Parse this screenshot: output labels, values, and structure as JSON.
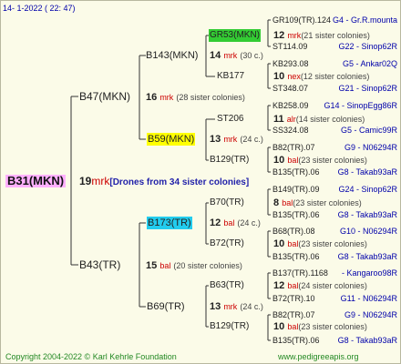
{
  "header": {
    "date": "14-  1-2022 ( 22: 47)"
  },
  "root": {
    "label": "B31(MKN)",
    "number": "19",
    "mark": "mrk",
    "note": "[Drones from 34 sister colonies]"
  },
  "branches": {
    "b47": {
      "label": "B47(MKN)",
      "number": "16",
      "mark": "mrk",
      "note": "(28 sister colonies)"
    },
    "b43": {
      "label": "B43(TR)",
      "number": "15",
      "mark": "bal",
      "note": "(20 sister colonies)"
    },
    "b143": {
      "label": "B143(MKN)",
      "number": "14",
      "mark": "mrk",
      "note": "(30 c.)"
    },
    "b59": {
      "label": "B59(MKN)",
      "number": "13",
      "mark": "mrk",
      "note": "(24 c.)"
    },
    "b173": {
      "label": "B173(TR)",
      "number": "12",
      "mark": "bal",
      "note": "(24 c.)"
    },
    "b69": {
      "label": "B69(TR)",
      "number": "13",
      "mark": "mrk",
      "note": "(24 c.)"
    },
    "gr53": {
      "label": "GR53(MKN)",
      "number": "12",
      "mark": "mrk",
      "note": "(21 sister colonies)"
    },
    "kb177": {
      "label": "KB177",
      "number": "10",
      "mark": "nex",
      "note": "(12 sister colonies)"
    },
    "st206": {
      "label": "ST206",
      "number": "11",
      "mark": "alr",
      "note": "(14 sister colonies)"
    },
    "b129a": {
      "label": "B129(TR)",
      "number": "10",
      "mark": "bal",
      "note": "(23 sister colonies)"
    },
    "b70": {
      "label": "B70(TR)",
      "number": "8",
      "mark": "bal",
      "note": "(23 sister colonies)"
    },
    "b72": {
      "label": "B72(TR)",
      "number": "10",
      "mark": "bal",
      "note": "(23 sister colonies)"
    },
    "b63": {
      "label": "B63(TR)",
      "number": "12",
      "mark": "bal",
      "note": "(24 sister colonies)"
    },
    "b129b": {
      "label": "B129(TR)",
      "number": "10",
      "mark": "bal",
      "note": "(23 sister colonies)"
    }
  },
  "leaves": [
    {
      "id": "GR109(TR).124",
      "region": "G4 - Gr.R.mounta"
    },
    {
      "id": "ST114.09",
      "region": "G22 - Sinop62R"
    },
    {
      "id": "KB293.08",
      "region": "G5 - Ankar02Q"
    },
    {
      "id": "ST348.07",
      "region": "G21 - Sinop62R"
    },
    {
      "id": "KB258.09",
      "region": "G14 - SinopEgg86R"
    },
    {
      "id": "SS324.08",
      "region": "G5 - Camic99R"
    },
    {
      "id": "B82(TR).07",
      "region": "G9 - N06294R"
    },
    {
      "id": "B135(TR).06",
      "region": "G8 - Takab93aR"
    },
    {
      "id": "B149(TR).09",
      "region": "G24 - Sinop62R"
    },
    {
      "id": "B135(TR).06",
      "region": "G8 - Takab93aR"
    },
    {
      "id": "B68(TR).08",
      "region": "G10 - N06294R"
    },
    {
      "id": "B135(TR).06",
      "region": "G8 - Takab93aR"
    },
    {
      "id": "B137(TR).1168",
      "region": "- Kangaroo98R"
    },
    {
      "id": "B72(TR).10",
      "region": "G11 - N06294R"
    },
    {
      "id": "B82(TR).07",
      "region": "G9 - N06294R"
    },
    {
      "id": "B135(TR).06",
      "region": "G8 - Takab93aR"
    }
  ],
  "footer": {
    "copyright": "Copyright 2004-2022 © Karl Kehrle Foundation",
    "site": "www.pedigreeapis.org"
  }
}
